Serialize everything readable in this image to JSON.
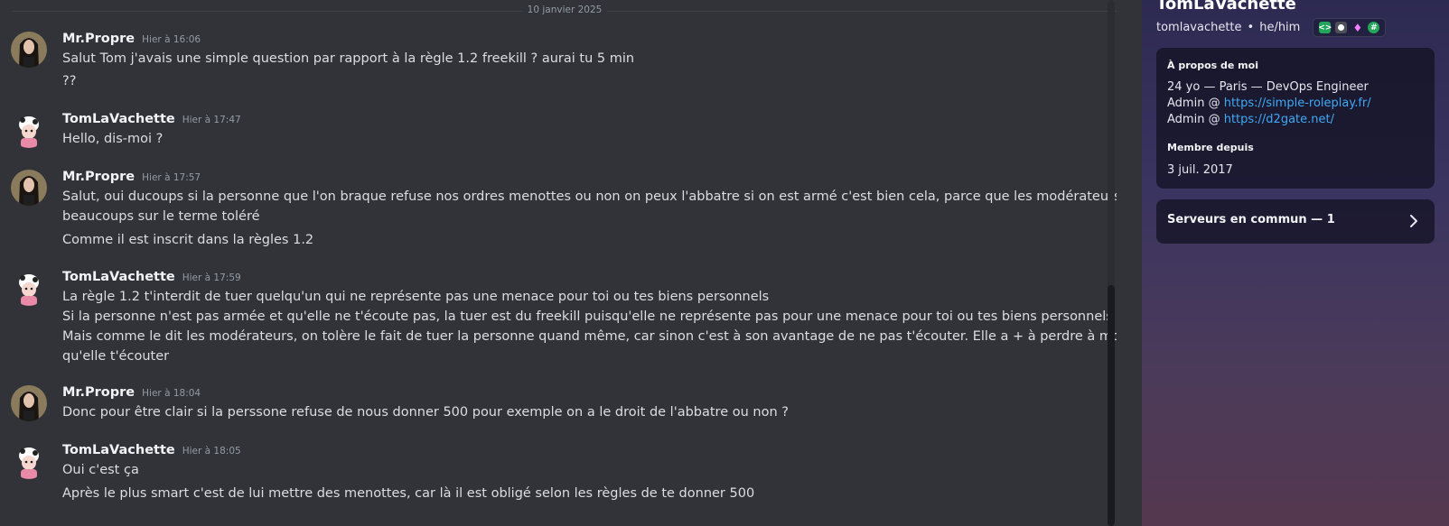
{
  "divider_date": "10 janvier 2025",
  "messages": [
    {
      "author": "Mr.Propre",
      "time": "Hier à 16:06",
      "lines": [
        "Salut Tom j'avais une simple question par rapport à la règle 1.2 freekill ? aurai tu 5 min",
        "??"
      ]
    },
    {
      "author": "TomLaVachette",
      "time": "Hier à 17:47",
      "lines": [
        "Hello, dis-moi ?"
      ]
    },
    {
      "author": "Mr.Propre",
      "time": "Hier à 17:57",
      "lines": [
        "Salut, oui ducoups si la personne que l'on braque refuse nos ordres menottes ou non on peux l'abbatre si on est armé c'est bien cela, parce que  les modérateurs joue",
        "beaucoups sur le terme toléré",
        "Comme il est inscrit dans la règles 1.2"
      ]
    },
    {
      "author": "TomLaVachette",
      "time": "Hier à 17:59",
      "lines": [
        "La règle 1.2 t'interdit de tuer quelqu'un qui ne représente pas une menace pour toi ou tes biens personnels",
        "Si la personne n'est pas armée et qu'elle ne t'écoute pas, la tuer est du freekill puisqu'elle ne représente pas pour une menace pour toi ou tes biens personnels",
        "Mais comme le dit les modérateurs, on tolère le fait de tuer la personne quand même, car sinon c'est à son avantage de ne pas t'écouter. Elle a + à perdre à mourir",
        "qu'elle t'écouter"
      ]
    },
    {
      "author": "Mr.Propre",
      "time": "Hier à 18:04",
      "lines": [
        "Donc pour être clair si la perssone refuse de nous donner 500 pour exemple on a le droit de l'abbatre ou non ?"
      ]
    },
    {
      "author": "TomLaVachette",
      "time": "Hier à 18:05",
      "lines": [
        "Oui c'est ça",
        "Après le plus smart c'est de lui mettre des menottes, car là il est obligé selon les règles de te donner 500"
      ]
    }
  ],
  "profile": {
    "display_name": "TomLaVachette",
    "username": "tomlavachette",
    "separator": "•",
    "pronouns": "he/him",
    "about_title": "À propos de moi",
    "about_line1": "24 yo — Paris — DevOps Engineer",
    "admin_prefix": "Admin @ ",
    "link1": "https://simple-roleplay.fr/",
    "link2": "https://d2gate.net/",
    "member_since_title": "Membre depuis",
    "member_since": "3 juil. 2017",
    "mutual_servers": "Serveurs en commun — 1"
  },
  "colors": {
    "link": "#3fa9f5",
    "background": "#313338",
    "author": "#f2f3f5"
  }
}
